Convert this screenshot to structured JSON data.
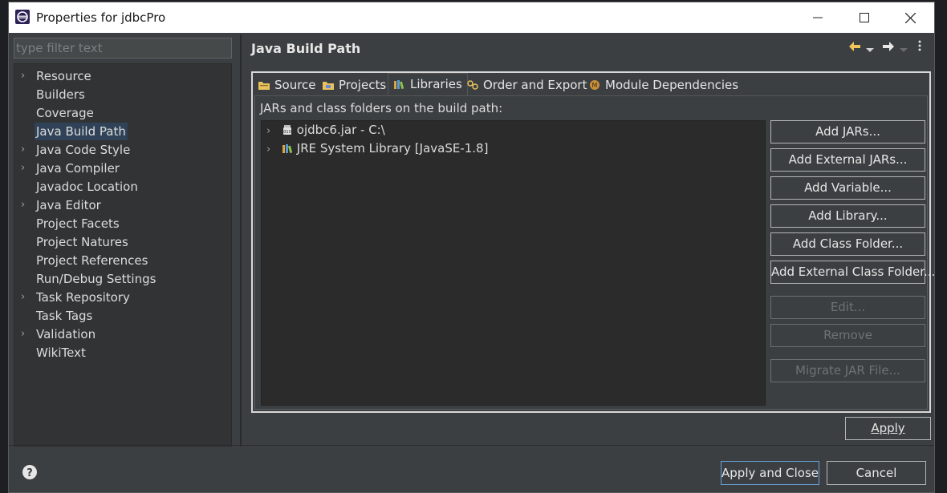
{
  "window": {
    "title": "Properties for jdbcPro"
  },
  "filter": {
    "placeholder": "type filter text"
  },
  "nav": {
    "items": [
      {
        "label": "Resource",
        "expandable": true
      },
      {
        "label": "Builders",
        "expandable": false
      },
      {
        "label": "Coverage",
        "expandable": false
      },
      {
        "label": "Java Build Path",
        "expandable": false,
        "selected": true
      },
      {
        "label": "Java Code Style",
        "expandable": true
      },
      {
        "label": "Java Compiler",
        "expandable": true
      },
      {
        "label": "Javadoc Location",
        "expandable": false
      },
      {
        "label": "Java Editor",
        "expandable": true
      },
      {
        "label": "Project Facets",
        "expandable": false
      },
      {
        "label": "Project Natures",
        "expandable": false
      },
      {
        "label": "Project References",
        "expandable": false
      },
      {
        "label": "Run/Debug Settings",
        "expandable": false
      },
      {
        "label": "Task Repository",
        "expandable": true
      },
      {
        "label": "Task Tags",
        "expandable": false
      },
      {
        "label": "Validation",
        "expandable": true
      },
      {
        "label": "WikiText",
        "expandable": false
      }
    ]
  },
  "page": {
    "title": "Java Build Path"
  },
  "tabs": [
    {
      "label": "Source",
      "icon": "source-folder-icon"
    },
    {
      "label": "Projects",
      "icon": "projects-icon"
    },
    {
      "label": "Libraries",
      "icon": "libraries-icon",
      "active": true
    },
    {
      "label": "Order and Export",
      "icon": "order-export-icon"
    },
    {
      "label": "Module Dependencies",
      "icon": "module-icon"
    }
  ],
  "libraries": {
    "caption": "JARs and class folders on the build path:",
    "entries": [
      {
        "label": "ojdbc6.jar - C:\\",
        "icon": "jar-icon"
      },
      {
        "label": "JRE System Library [JavaSE-1.8]",
        "icon": "library-icon"
      }
    ]
  },
  "buttons": {
    "add_jars": "Add JARs...",
    "add_external_jars": "Add External JARs...",
    "add_variable": "Add Variable...",
    "add_library": "Add Library...",
    "add_class_folder": "Add Class Folder...",
    "add_external_class_folder": "Add External Class Folder...",
    "edit": "Edit...",
    "remove": "Remove",
    "migrate_jar": "Migrate JAR File..."
  },
  "footer": {
    "apply": "Apply",
    "apply_and_close": "Apply and Close",
    "cancel": "Cancel"
  },
  "colors": {
    "panel": "#3c3f41",
    "tree_bg": "#2b2b2b",
    "selection": "#2f4257",
    "titlebar": "#ffffff"
  }
}
